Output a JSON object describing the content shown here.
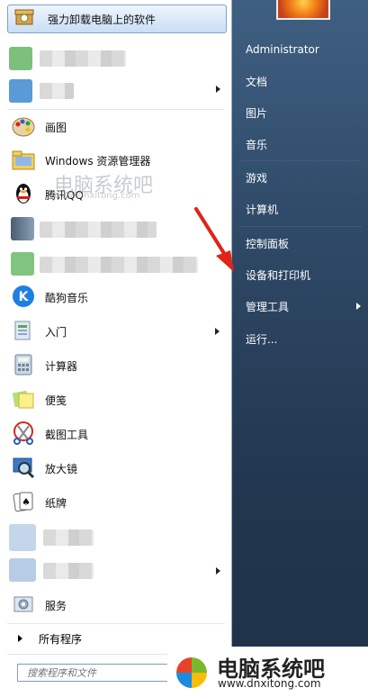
{
  "left_panel": {
    "pinned_first": {
      "label": "强力卸载电脑上的软件"
    },
    "items": [
      {
        "label": "画图"
      },
      {
        "label": "Windows 资源管理器"
      },
      {
        "label": "腾讯QQ"
      },
      {
        "label": "酷狗音乐"
      },
      {
        "label": "入门"
      },
      {
        "label": "计算器"
      },
      {
        "label": "便笺"
      },
      {
        "label": "截图工具"
      },
      {
        "label": "放大镜"
      },
      {
        "label": "纸牌"
      },
      {
        "label": "服务"
      }
    ],
    "all_programs": "所有程序",
    "search_placeholder": "搜索程序和文件"
  },
  "right_panel": {
    "items": [
      {
        "label": "Administrator"
      },
      {
        "label": "文档"
      },
      {
        "label": "图片"
      },
      {
        "label": "音乐"
      },
      {
        "label": "游戏"
      },
      {
        "label": "计算机"
      },
      {
        "label": "控制面板"
      },
      {
        "label": "设备和打印机"
      },
      {
        "label": "管理工具"
      },
      {
        "label": "运行..."
      }
    ]
  },
  "watermark_top": {
    "title": "电脑系统吧",
    "url": "www.dnxitong.com"
  },
  "watermark_bottom": {
    "title": "电脑系统吧",
    "url": "www.dnxitong.com"
  },
  "colors": {
    "accent_red": "#e2231a",
    "panel_blue": "#2e4866"
  }
}
